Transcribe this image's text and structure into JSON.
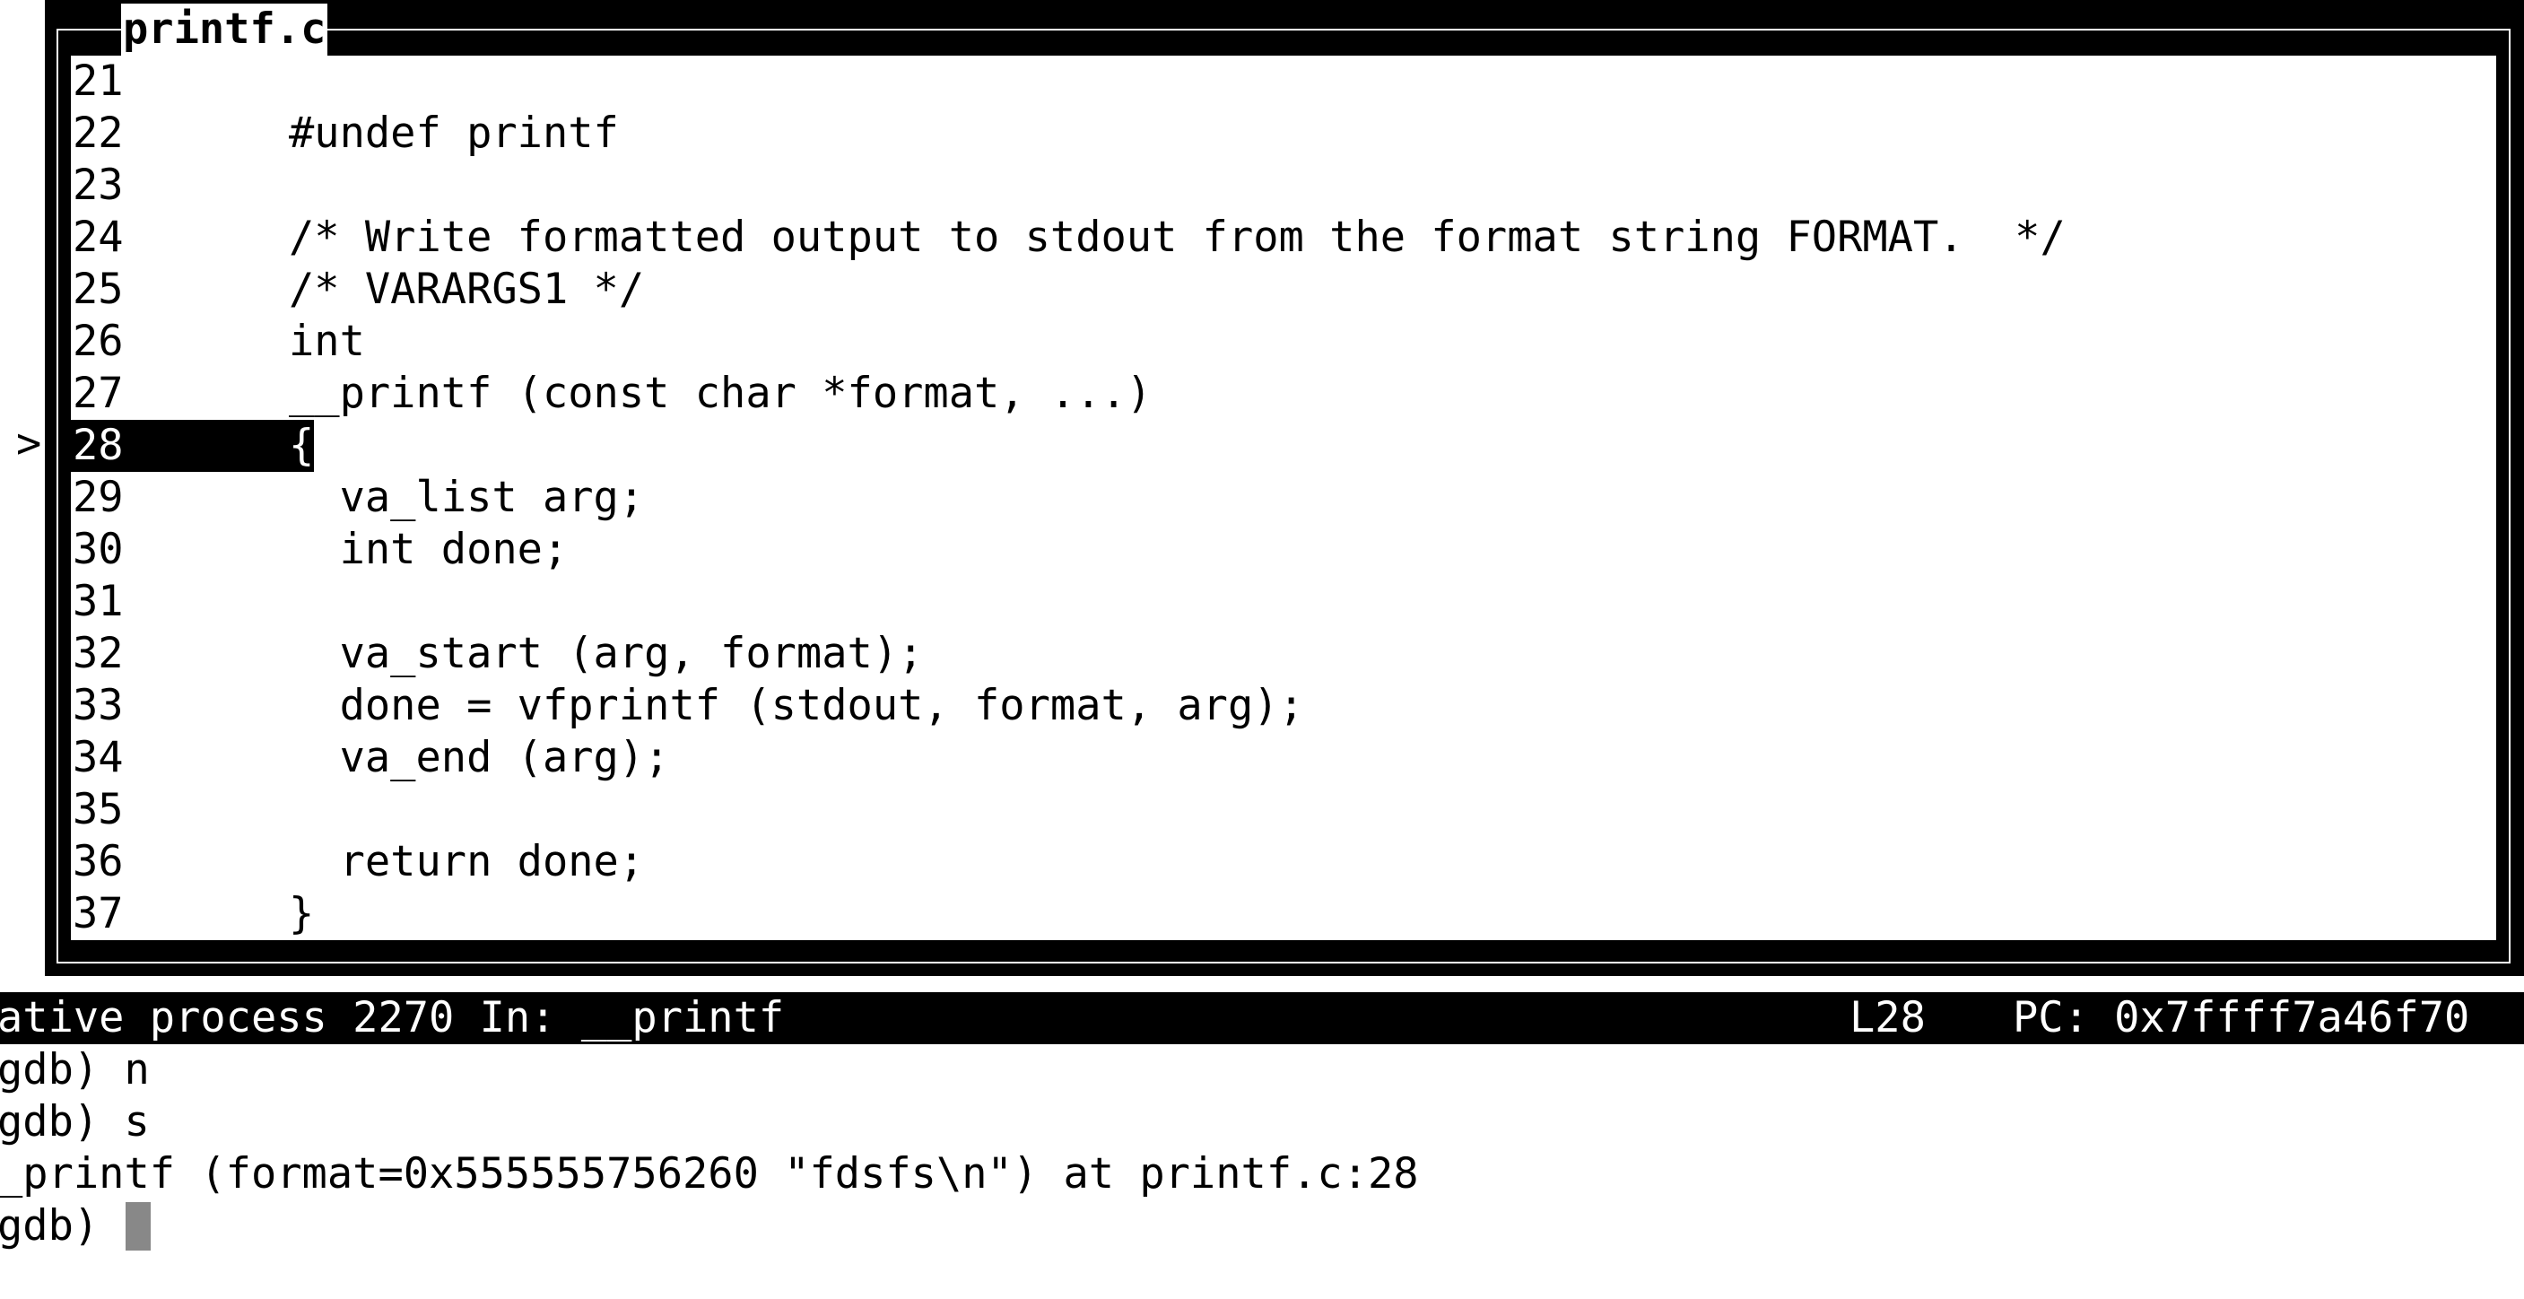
{
  "source_window": {
    "title": "printf.c",
    "pc_marker": ">",
    "lines": [
      {
        "num": "21",
        "code": ""
      },
      {
        "num": "22",
        "code": "#undef printf"
      },
      {
        "num": "23",
        "code": ""
      },
      {
        "num": "24",
        "code": "/* Write formatted output to stdout from the format string FORMAT.  */"
      },
      {
        "num": "25",
        "code": "/* VARARGS1 */"
      },
      {
        "num": "26",
        "code": "int"
      },
      {
        "num": "27",
        "code": "__printf (const char *format, ...)"
      },
      {
        "num": "28",
        "code": "{"
      },
      {
        "num": "29",
        "code": "  va_list arg;"
      },
      {
        "num": "30",
        "code": "  int done;"
      },
      {
        "num": "31",
        "code": ""
      },
      {
        "num": "32",
        "code": "  va_start (arg, format);"
      },
      {
        "num": "33",
        "code": "  done = vfprintf (stdout, format, arg);"
      },
      {
        "num": "34",
        "code": "  va_end (arg);"
      },
      {
        "num": "35",
        "code": ""
      },
      {
        "num": "36",
        "code": "  return done;"
      },
      {
        "num": "37",
        "code": "}"
      }
    ]
  },
  "status_bar": {
    "left": "ative process 2270 In: __printf",
    "line": "L28",
    "pc": "PC: 0x7ffff7a46f70"
  },
  "console": {
    "lines": [
      "gdb) n",
      "gdb) s",
      "_printf (format=0x555555756260 \"fdsfs\\n\") at printf.c:28",
      "gdb) "
    ]
  },
  "colors": {
    "background": "#ffffff",
    "foreground": "#000000",
    "cursor": "#888888"
  }
}
